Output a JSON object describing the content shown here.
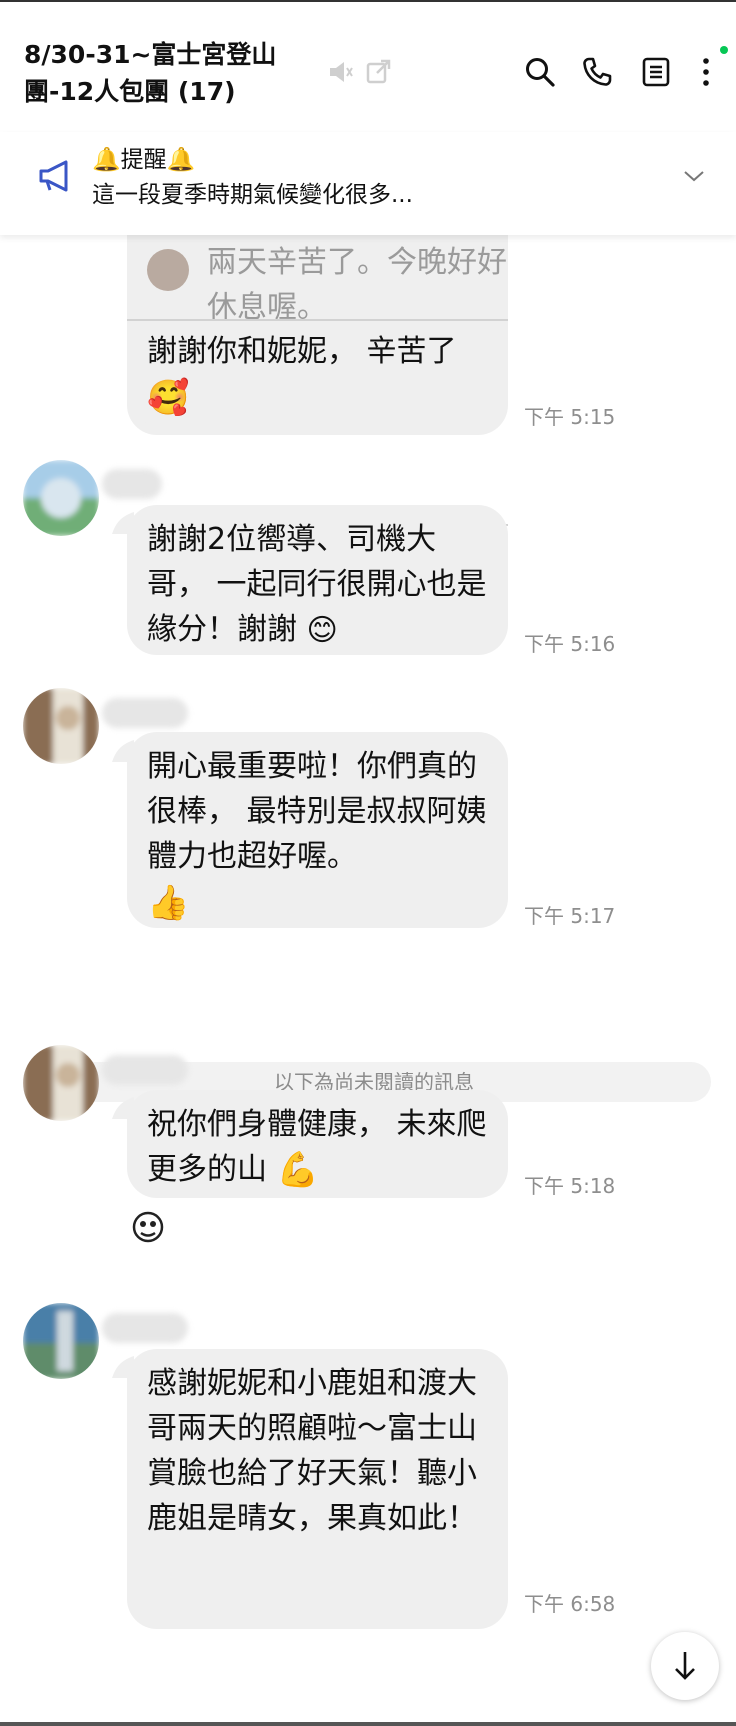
{
  "header": {
    "title": "8/30-31~富士宮登山團-12人包團 (17)"
  },
  "announcement": {
    "title": "🔔提醒🔔",
    "text": "這一段夏季時期氣候變化很多..."
  },
  "messages": [
    {
      "quote_text": "兩天辛苦了。今晚好好休息喔。",
      "text": "謝謝你和妮妮， 辛苦了",
      "emoji": "🥰",
      "time": "下午 5:15"
    },
    {
      "text": "謝謝2位嚮導、司機大哥， 一起同行很開心也是緣分！謝謝",
      "emoji": "😊",
      "time": "下午 5:16"
    },
    {
      "text": "開心最重要啦！你們真的很棒， 最特別是叔叔阿姨體力也超好喔。",
      "emoji": "👍",
      "time": "下午 5:17"
    },
    {
      "text": "祝你們身體健康， 未來爬更多的山",
      "emoji": "💪",
      "time": "下午 5:18"
    },
    {
      "text": "感謝妮妮和小鹿姐和渡大哥兩天的照顧啦～富士山賞臉也給了好天氣！聽小鹿姐是晴女，果真如此！",
      "time": "下午 6:58"
    }
  ],
  "unread_divider": "以下為尚未閱讀的訊息",
  "icons": [
    "mute-icon",
    "popout-icon",
    "search-icon",
    "phone-icon",
    "notes-icon",
    "more-icon",
    "megaphone-icon",
    "chevron-down-icon",
    "arrow-down-icon"
  ],
  "colors": {
    "bubble": "#efefef",
    "accent_dot": "#06c755",
    "time": "#8e8e8e"
  }
}
